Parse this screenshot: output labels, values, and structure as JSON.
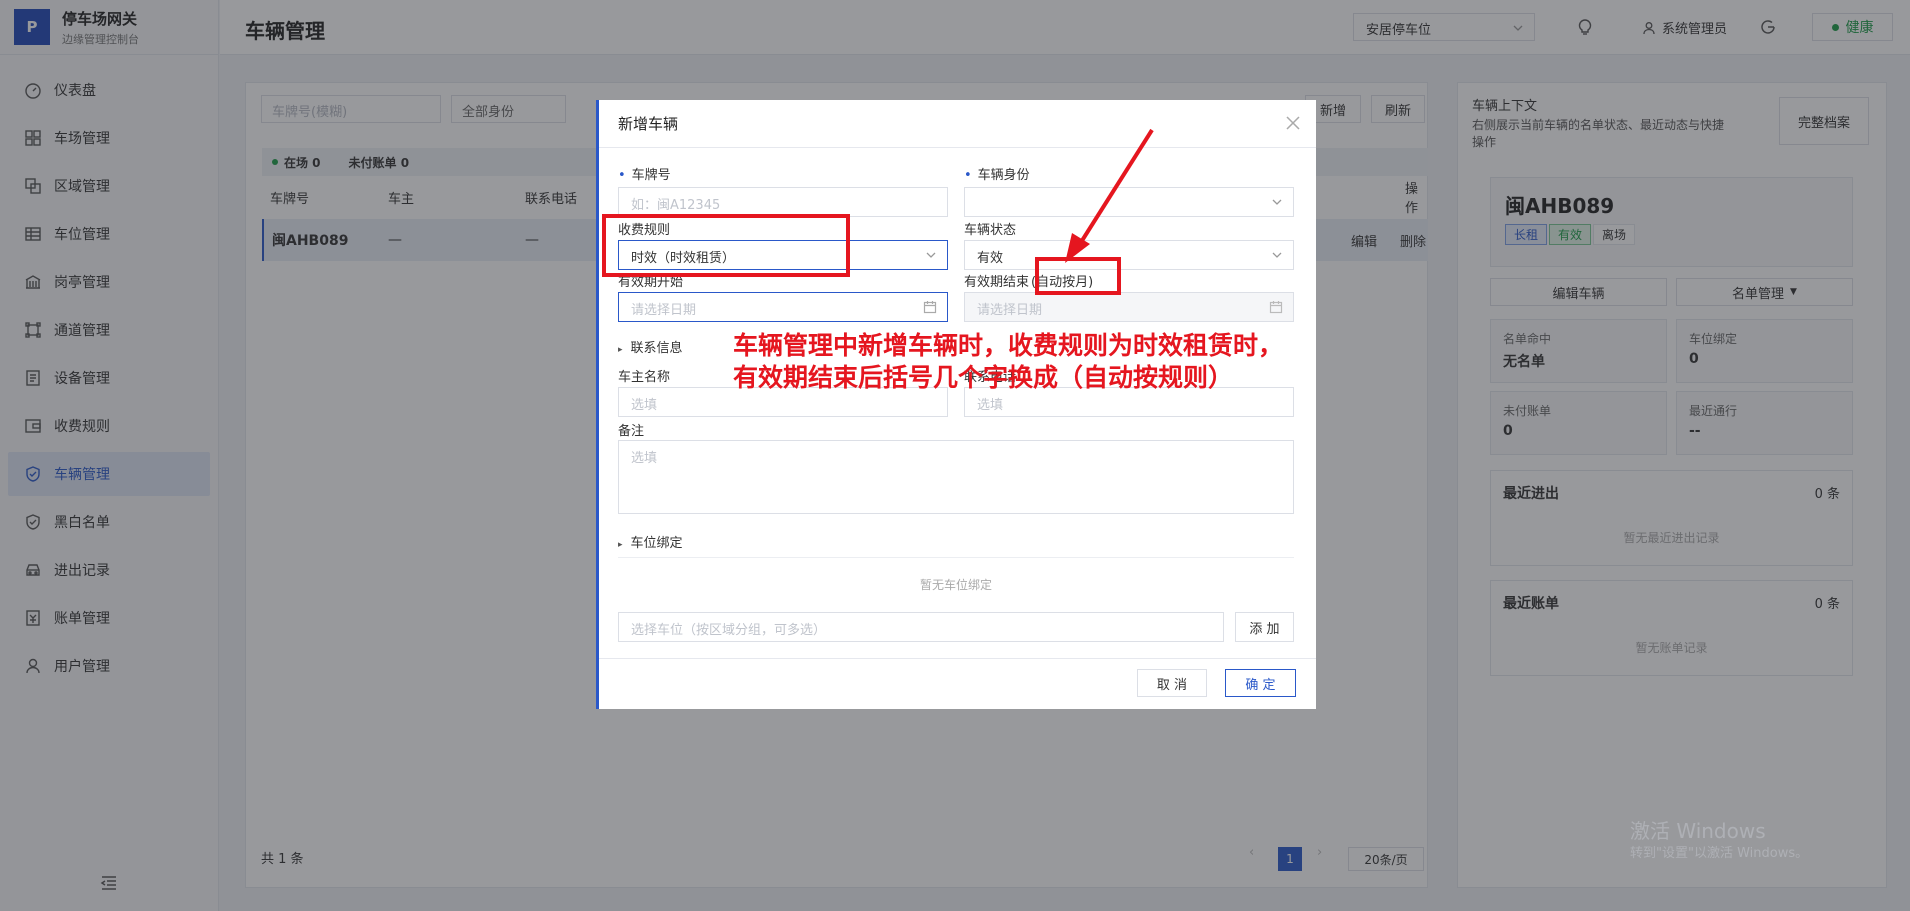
{
  "app": {
    "logo_letter": "P",
    "title": "停车场网关",
    "subtitle": "边缘管理控制台"
  },
  "sidebar": {
    "items": [
      {
        "label": "仪表盘",
        "icon": "dashboard-icon"
      },
      {
        "label": "车场管理",
        "icon": "grid-icon"
      },
      {
        "label": "区域管理",
        "icon": "area-icon"
      },
      {
        "label": "车位管理",
        "icon": "table-icon"
      },
      {
        "label": "岗亭管理",
        "icon": "building-icon"
      },
      {
        "label": "通道管理",
        "icon": "channel-icon"
      },
      {
        "label": "设备管理",
        "icon": "device-icon"
      },
      {
        "label": "收费规则",
        "icon": "wallet-icon"
      },
      {
        "label": "车辆管理",
        "icon": "shield-icon",
        "active": true
      },
      {
        "label": "黑白名单",
        "icon": "shield-check-icon"
      },
      {
        "label": "进出记录",
        "icon": "car-icon"
      },
      {
        "label": "账单管理",
        "icon": "bill-icon"
      },
      {
        "label": "用户管理",
        "icon": "user-icon"
      }
    ]
  },
  "topbar": {
    "page_title": "车辆管理",
    "site": "安居停车位",
    "user": "系统管理员",
    "health": "健康"
  },
  "filters": {
    "plate_placeholder": "车牌号(模糊)",
    "identity": "全部身份",
    "add": "新增",
    "refresh": "刷新"
  },
  "stats": {
    "on_site": "在场 0",
    "unpaid": "未付账单 0"
  },
  "table": {
    "headers": [
      "车牌号",
      "车主",
      "联系电话",
      "操作"
    ],
    "rows": [
      {
        "plate": "闽AHB089",
        "owner": "—",
        "phone": "—",
        "edit": "编辑",
        "delete": "删除"
      }
    ],
    "total": "共 1 条",
    "page": "1",
    "page_size": "20条/页"
  },
  "context": {
    "title": "车辆上下文",
    "desc": "右侧展示当前车辆的名单状态、最近动态与快捷操作",
    "full_record": "完整档案",
    "plate": "闽AHB089",
    "tags": [
      "长租",
      "有效",
      "离场"
    ],
    "edit_vehicle": "编辑车辆",
    "list_manage": "名单管理",
    "stats": [
      {
        "label": "名单命中",
        "value": "无名单"
      },
      {
        "label": "车位绑定",
        "value": "0"
      },
      {
        "label": "未付账单",
        "value": "0"
      },
      {
        "label": "最近通行",
        "value": "--"
      }
    ],
    "recent_access": {
      "title": "最近进出",
      "count": "0 条",
      "empty": "暂无最近进出记录"
    },
    "recent_bills": {
      "title": "最近账单",
      "count": "0 条",
      "empty": "暂无账单记录"
    }
  },
  "modal": {
    "title": "新增车辆",
    "plate_label": "车牌号",
    "plate_placeholder": "如：闽A12345",
    "identity_label": "车辆身份",
    "fee_rule_label": "收费规则",
    "fee_rule_value": "时效（时效租赁）",
    "status_label": "车辆状态",
    "status_value": "有效",
    "valid_start_label": "有效期开始",
    "valid_start_placeholder": "请选择日期",
    "valid_end_label": "有效期结束",
    "valid_end_suffix": "(自动按月)",
    "valid_end_placeholder": "请选择日期",
    "contact_section": "联系信息",
    "owner_name_label": "车主名称",
    "owner_name_placeholder": "选填",
    "phone_label": "联系电话",
    "phone_placeholder": "选填",
    "remark_label": "备注",
    "remark_placeholder": "选填",
    "space_section": "车位绑定",
    "space_empty": "暂无车位绑定",
    "space_placeholder": "选择车位（按区域分组，可多选）",
    "add": "添 加",
    "cancel": "取 消",
    "confirm": "确 定"
  },
  "annotation": {
    "line1": "车辆管理中新增车辆时，收费规则为时效租赁时，",
    "line2": "有效期结束后括号几个字换成（自动按规则）"
  },
  "watermark": {
    "title": "激活 Windows",
    "sub": "转到\"设置\"以激活 Windows。"
  },
  "colors": {
    "brand": "#1f48b8",
    "accent": "#2a58c9",
    "success": "#1c9d48",
    "annotation": "#e5161f"
  }
}
